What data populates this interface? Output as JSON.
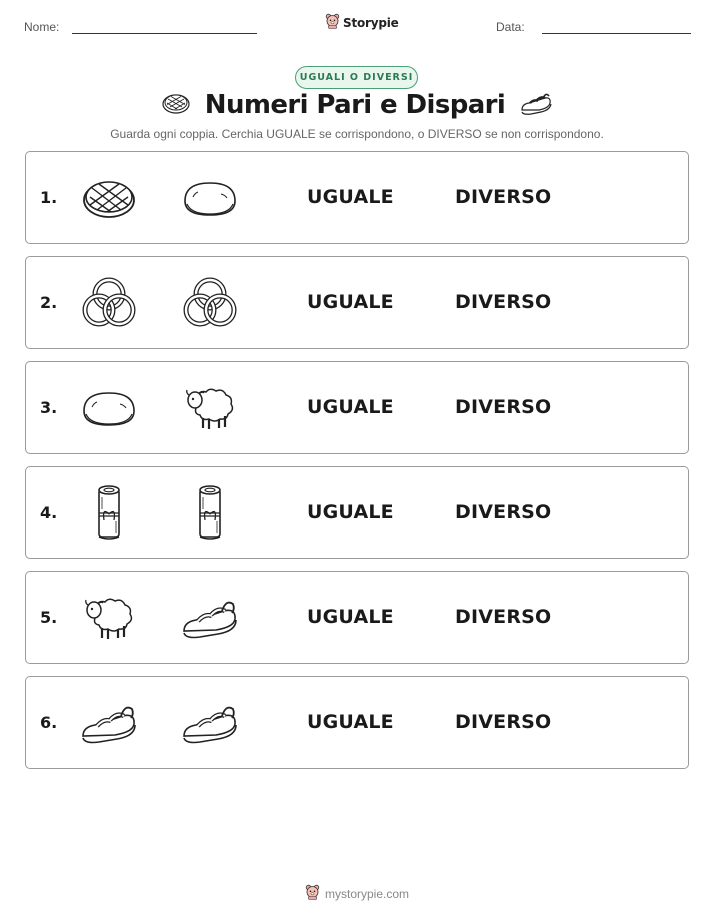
{
  "header": {
    "name_label": "Nome:",
    "date_label": "Data:",
    "brand": "Storypie"
  },
  "badge": "UGUALI O DIVERSI",
  "title": "Numeri Pari e Dispari",
  "instructions": "Guarda ogni coppia. Cerchia UGUALE se corrispondono, o DIVERSO se non corrispondono.",
  "options": {
    "same": "UGUALE",
    "different": "DIVERSO"
  },
  "rows": [
    {
      "number": "1.",
      "left": "flatbread",
      "right": "bread-loaf"
    },
    {
      "number": "2.",
      "left": "trinity-rings",
      "right": "trinity-rings"
    },
    {
      "number": "3.",
      "left": "bread-loaf",
      "right": "sheep"
    },
    {
      "number": "4.",
      "left": "scroll",
      "right": "scroll"
    },
    {
      "number": "5.",
      "left": "sheep",
      "right": "sandal"
    },
    {
      "number": "6.",
      "left": "sandal",
      "right": "sandal"
    }
  ],
  "footer": {
    "url": "mystorypie.com"
  }
}
